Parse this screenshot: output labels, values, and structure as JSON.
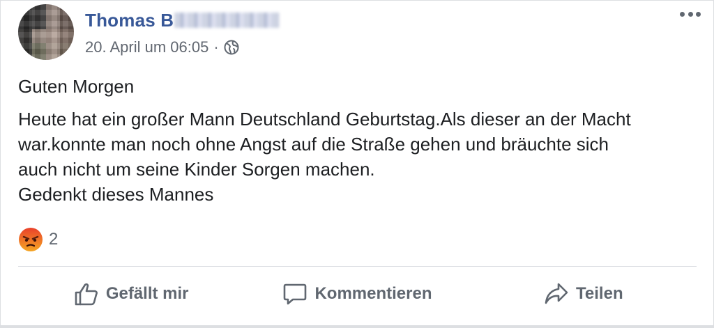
{
  "post": {
    "author_first": "Thomas B",
    "author_rest_blurred": "[pixelated]",
    "date": "20. April um 06:05",
    "separator": "·",
    "privacy_icon": "globe-icon",
    "more_icon": "more-horizontal-icon",
    "greeting": "Guten Morgen",
    "body": "Heute hat ein großer Mann Deutschland Geburtstag.Als dieser an der Macht\nwar.konnte man noch ohne Angst auf die Straße gehen und bräuchte sich\nauch nicht um seine Kinder Sorgen machen.\nGedenkt dieses Mannes"
  },
  "reactions": {
    "icon": "angry-reaction-icon",
    "count": "2"
  },
  "actions": {
    "like_label": "Gefällt mir",
    "comment_label": "Kommentieren",
    "share_label": "Teilen"
  },
  "colors": {
    "author_link": "#385898",
    "meta_text": "#616770",
    "body_text": "#1c1e21",
    "angry_orange": "#f0752b"
  }
}
